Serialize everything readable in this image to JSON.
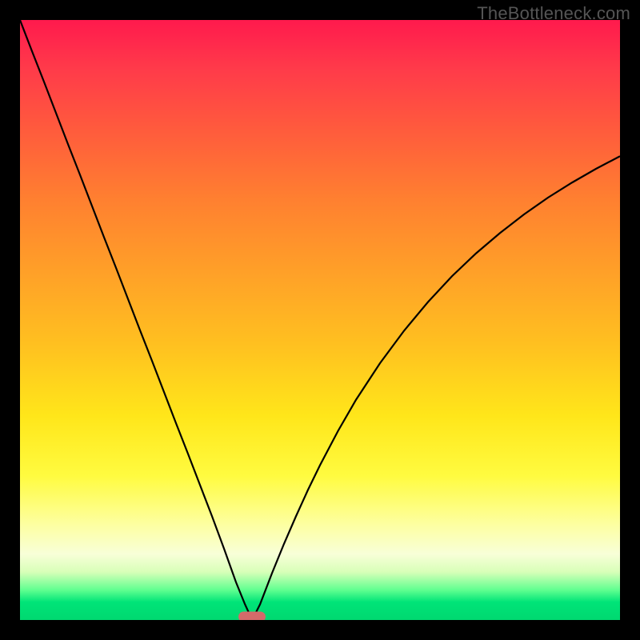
{
  "watermark": "TheBottleneck.com",
  "colors": {
    "frame_border": "#000000",
    "gradient_top": "#ff1a4d",
    "gradient_mid1": "#ff8030",
    "gradient_mid2": "#ffe61a",
    "gradient_bottom": "#00d870",
    "curve_stroke": "#000000",
    "marker_fill": "#d46a6a"
  },
  "chart_data": {
    "type": "line",
    "title": "",
    "xlabel": "",
    "ylabel": "",
    "xlim": [
      0,
      100
    ],
    "ylim": [
      0,
      100
    ],
    "grid": false,
    "legend": false,
    "notes": "V-shaped bottleneck curve on rainbow gradient background; minimum at ~x=38.7; y-axis inverted visually (0 at bottom = green/optimal, 100 at top = red/severe bottleneck).",
    "series": [
      {
        "name": "bottleneck-curve-left",
        "x": [
          0.0,
          2.0,
          4.0,
          6.0,
          8.0,
          10.0,
          12.0,
          14.0,
          16.0,
          18.0,
          20.0,
          22.0,
          24.0,
          26.0,
          28.0,
          30.0,
          32.0,
          34.0,
          36.0,
          37.5,
          38.7
        ],
        "y": [
          100.0,
          94.8,
          89.7,
          84.5,
          79.3,
          74.2,
          69.0,
          63.8,
          58.7,
          53.5,
          48.3,
          43.2,
          38.0,
          32.8,
          27.7,
          22.5,
          17.3,
          11.9,
          6.3,
          2.6,
          0.0
        ]
      },
      {
        "name": "bottleneck-curve-right",
        "x": [
          38.7,
          40.0,
          42.0,
          44.0,
          46.0,
          48.0,
          50.0,
          53.0,
          56.0,
          60.0,
          64.0,
          68.0,
          72.0,
          76.0,
          80.0,
          84.0,
          88.0,
          92.0,
          96.0,
          100.0
        ],
        "y": [
          0.0,
          2.6,
          7.8,
          12.7,
          17.3,
          21.7,
          25.8,
          31.5,
          36.7,
          42.8,
          48.2,
          53.0,
          57.3,
          61.1,
          64.5,
          67.6,
          70.4,
          72.9,
          75.2,
          77.3
        ]
      }
    ],
    "marker": {
      "x": 38.7,
      "y": 0.5,
      "shape": "rounded-rect"
    }
  }
}
